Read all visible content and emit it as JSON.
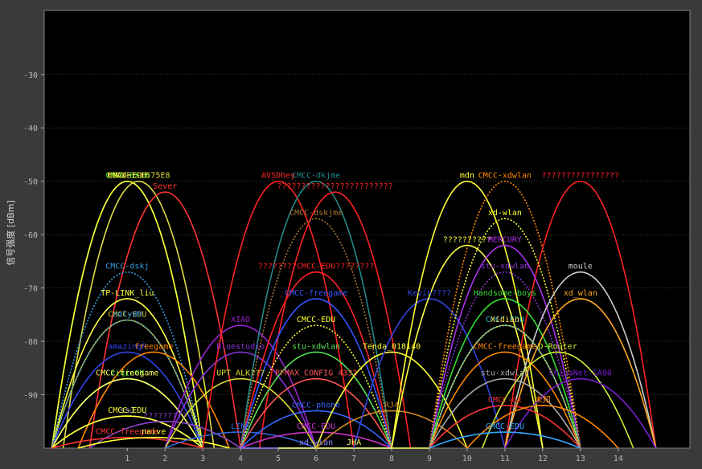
{
  "chart_data": {
    "type": "area",
    "ylabel": "信号强度 [dBm]",
    "xlabel": "",
    "xlim": [
      -1.2,
      15.9
    ],
    "ylim": [
      -100,
      -18
    ],
    "xticks": [
      1,
      2,
      3,
      4,
      5,
      6,
      7,
      8,
      9,
      10,
      11,
      12,
      13,
      14
    ],
    "yticks": [
      -30,
      -40,
      -50,
      -60,
      -70,
      -80,
      -90
    ],
    "grid": true,
    "background": "#000000",
    "gridColor": "#5a5a5a",
    "series": [
      {
        "name": "CMCC-8XJm",
        "ch": 1,
        "dBm": -50,
        "color": "#33dd33",
        "dash": false
      },
      {
        "name": "CMCC-EDU",
        "ch": 1,
        "dBm": -50,
        "color": "#ffff33",
        "dash": false
      },
      {
        "name": "HUAWEI-E575E8",
        "ch": 1.3,
        "dBm": -50,
        "color": "#dddd44",
        "dash": false
      },
      {
        "name": "Sever",
        "ch": 2,
        "dBm": -52,
        "color": "#ff3333",
        "dash": false
      },
      {
        "name": "CMCC-dskj",
        "ch": 1,
        "dBm": -67,
        "color": "#3399dd",
        "dash": true
      },
      {
        "name": "TP-LINK_liu",
        "ch": 1,
        "dBm": -72,
        "color": "#ffff44",
        "dash": false
      },
      {
        "name": "CMCC-EDU",
        "ch": 1,
        "dBm": -76,
        "color": "#cccc33",
        "dash": false
      },
      {
        "name": "emlyNM",
        "ch": 1,
        "dBm": -76,
        "color": "#3388cc",
        "dash": true
      },
      {
        "name": "amazingR",
        "ch": 1,
        "dBm": -82,
        "color": "#3344ee",
        "dash": false
      },
      {
        "name": "freegame",
        "ch": 1.7,
        "dBm": -82,
        "color": "#ff8800",
        "dash": false
      },
      {
        "name": "ziqinGK",
        "ch": 1,
        "dBm": -87,
        "color": "#44dd44",
        "dash": false
      },
      {
        "name": "CMCC-freegame",
        "ch": 1,
        "dBm": -87,
        "color": "#ffff66",
        "dash": false
      },
      {
        "name": "ssJ",
        "ch": 1,
        "dBm": -94,
        "color": "#cccccc",
        "dash": false
      },
      {
        "name": "CMCC-EDU",
        "ch": 1,
        "dBm": -94,
        "color": "#ffff33",
        "dash": false
      },
      {
        "name": "?????????",
        "ch": 2,
        "dBm": -95,
        "color": "#8844cc",
        "dash": false
      },
      {
        "name": "CMCC-freegame",
        "ch": 1,
        "dBm": -98,
        "color": "#ff3333",
        "dash": false
      },
      {
        "name": "naive",
        "ch": 1.7,
        "dBm": -98,
        "color": "#ffff33",
        "dash": false
      },
      {
        "name": "XIAO",
        "ch": 4,
        "dBm": -77,
        "color": "#9922cc",
        "dash": false
      },
      {
        "name": "Bluestudio",
        "ch": 4,
        "dBm": -82,
        "color": "#8833dd",
        "dash": false
      },
      {
        "name": "UPT_ALK???",
        "ch": 4,
        "dBm": -87,
        "color": "#dddd33",
        "dash": false
      },
      {
        "name": "LINK",
        "ch": 4,
        "dBm": -97,
        "color": "#3366dd",
        "dash": false
      },
      {
        "name": "AVSDhey",
        "ch": 5,
        "dBm": -50,
        "color": "#ff2222",
        "dash": false
      },
      {
        "name": "CMCC-dkjme",
        "ch": 6,
        "dBm": -50,
        "color": "#228888",
        "dash": false
      },
      {
        "name": "????????????????????????",
        "ch": 6.5,
        "dBm": -52,
        "color": "#ff2222",
        "dash": false
      },
      {
        "name": "CMCC-dskjme",
        "ch": 6,
        "dBm": -57,
        "color": "#aa7733",
        "dash": true
      },
      {
        "name": "????????CMCC-EDU????????",
        "ch": 6,
        "dBm": -67,
        "color": "#ff2222",
        "dash": false
      },
      {
        "name": "CMCC-freegame",
        "ch": 6,
        "dBm": -72,
        "color": "#3355ff",
        "dash": false
      },
      {
        "name": "CMCC-EDU",
        "ch": 6,
        "dBm": -77,
        "color": "#ffff33",
        "dash": true
      },
      {
        "name": "stu-xdwlan",
        "ch": 6,
        "dBm": -82,
        "color": "#55dd55",
        "dash": false
      },
      {
        "name": "PFMAX_CONFIG_4332",
        "ch": 6,
        "dBm": -87,
        "color": "#ff5555",
        "dash": false
      },
      {
        "name": "CMCC-phone",
        "ch": 6,
        "dBm": -93,
        "color": "#3366ff",
        "dash": false
      },
      {
        "name": "CMCC-EDU",
        "ch": 6,
        "dBm": -97,
        "color": "#cc33cc",
        "dash": false
      },
      {
        "name": "xd-wlan",
        "ch": 6,
        "dBm": -100,
        "color": "#8888ff",
        "dash": false
      },
      {
        "name": "JHA",
        "ch": 7,
        "dBm": -100,
        "color": "#ffff66",
        "dash": false
      },
      {
        "name": "Tenda_018140",
        "ch": 8,
        "dBm": -82,
        "color": "#ffff33",
        "dash": false
      },
      {
        "name": "RJ4",
        "ch": 8,
        "dBm": -93,
        "color": "#cc8822",
        "dash": false
      },
      {
        "name": "Kevin????",
        "ch": 9,
        "dBm": -72,
        "color": "#3344dd",
        "dash": false
      },
      {
        "name": "mdn",
        "ch": 10,
        "dBm": -50,
        "color": "#ffff33",
        "dash": false
      },
      {
        "name": "CMCC-xdwlan",
        "ch": 11,
        "dBm": -50,
        "color": "#ff8800",
        "dash": true
      },
      {
        "name": "????????????????",
        "ch": 13,
        "dBm": -50,
        "color": "#ff2222",
        "dash": false
      },
      {
        "name": "xd-wlan",
        "ch": 11,
        "dBm": -57,
        "color": "#ffff33",
        "dash": true
      },
      {
        "name": "??????????",
        "ch": 10,
        "dBm": -62,
        "color": "#ffff44",
        "dash": false
      },
      {
        "name": "MERCURY",
        "ch": 11,
        "dBm": -62,
        "color": "#aa33ee",
        "dash": false
      },
      {
        "name": "stu-xdwlan",
        "ch": 11,
        "dBm": -67,
        "color": "#8833cc",
        "dash": true
      },
      {
        "name": "moule",
        "ch": 13,
        "dBm": -67,
        "color": "#cccccc",
        "dash": false
      },
      {
        "name": "Handsome-boys",
        "ch": 11,
        "dBm": -72,
        "color": "#33dd33",
        "dash": false
      },
      {
        "name": "xd_wlan",
        "ch": 13,
        "dBm": -72,
        "color": "#ffaa22",
        "dash": false
      },
      {
        "name": "CMCC-EDU",
        "ch": 11,
        "dBm": -77,
        "color": "#33bbcc",
        "dash": false
      },
      {
        "name": "Xidian",
        "ch": 11,
        "dBm": -77,
        "color": "#ffcc33",
        "dash": true
      },
      {
        "name": "CMCC-freegame",
        "ch": 11,
        "dBm": -82,
        "color": "#ff8800",
        "dash": false
      },
      {
        "name": "D-Router",
        "ch": 12.4,
        "dBm": -82,
        "color": "#ccee33",
        "dash": false
      },
      {
        "name": "stu-xdwlan",
        "ch": 11,
        "dBm": -87,
        "color": "#aaaaaa",
        "dash": false
      },
      {
        "name": "ChinaNet-SA90",
        "ch": 13,
        "dBm": -87,
        "color": "#7722cc",
        "dash": false
      },
      {
        "name": "CMCC-dx",
        "ch": 11,
        "dBm": -92,
        "color": "#ff3333",
        "dash": false
      },
      {
        "name": "未知",
        "ch": 12,
        "dBm": -92,
        "color": "#ff8800",
        "dash": false
      },
      {
        "name": "CMCC-EDU",
        "ch": 11,
        "dBm": -97,
        "color": "#33aaff",
        "dash": false
      }
    ]
  }
}
